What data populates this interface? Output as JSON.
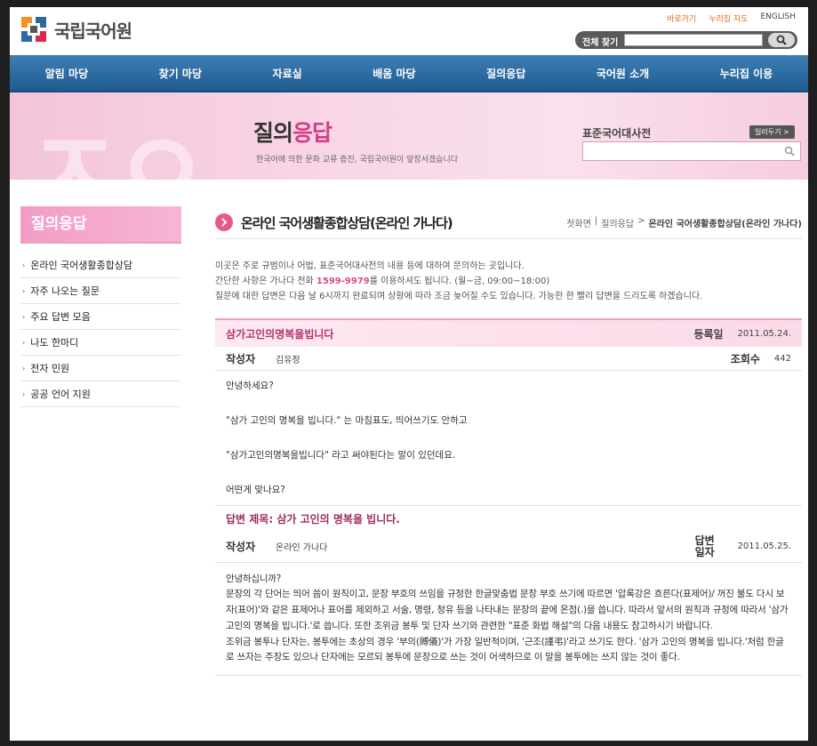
{
  "header": {
    "logo_text": "국립국어원",
    "util_links": [
      "바로가기",
      "누리집 지도",
      "ENGLISH"
    ],
    "search_label": "전체 찾기",
    "search_value": ""
  },
  "nav": [
    "알림 마당",
    "찾기 마당",
    "자료실",
    "배움 마당",
    "질의응답",
    "국어원 소개",
    "누리집 이용"
  ],
  "banner": {
    "title_part1": "질의",
    "title_part2": "응답",
    "subtitle": "한국어에 의한 문화 교류 증진, 국립국어원이 앞장서겠습니다",
    "dict_label": "표준국어대사전",
    "dict_more": "일러두기 >"
  },
  "sidebar": {
    "title": "질의응답",
    "items": [
      "온라인 국어생활종합상담",
      "자주 나오는 질문",
      "주요 답변 모음",
      "나도 한마디",
      "전자 민원",
      "공공 언어 지원"
    ]
  },
  "main": {
    "title": "온라인 국어생활종합상담(온라인 가나다)",
    "breadcrumb": [
      "첫화면",
      "질의응답",
      "온라인 국어생활종합상담(온라인 가나다)"
    ],
    "intro_line1": "이곳은 주로 규범이나 어법, 표준국어대사전의 내용 등에 대하여 문의하는 곳입니다.",
    "intro_line2_pre": "간단한 사항은 가나다 전화 ",
    "intro_phone": "1599-9979",
    "intro_line2_post": "를 이용하셔도 됩니다. (월~금, 09:00~18:00)",
    "intro_line3": "질문에 대한 답변은 다음 날 6시까지 완료되며 상황에 따라 조금 늦어질 수도 있습니다. 가능한 한 빨리 답변을 드리도록 하겠습니다."
  },
  "question": {
    "subject": "삼가고인의명복을빕니다",
    "date_label": "등록일",
    "date": "2011.05.24.",
    "author_label": "작성자",
    "author": "김유정",
    "views_label": "조회수",
    "views": "442",
    "body": [
      "안녕하세요?",
      "\"삼가 고인의 명복을 빕니다.\" 는 마침표도, 띄어쓰기도 안하고",
      "\"삼가고인의명복을빕니다\" 라고 써야된다는 말이 있던데요.",
      "어떤게 맞나요?"
    ]
  },
  "answer": {
    "title": "답변 제목: 삼가 고인의 명복을 빕니다.",
    "author_label": "작성자",
    "author": "온라인 가나다",
    "date_label": "답변일자",
    "date": "2011.05.25.",
    "body": [
      "안녕하십니까?",
      "문장의 각 단어는 띄어 씀이 원칙이고, 문장 부호의 쓰임을 규정한 한글맞춤법 문장 부호 쓰기에 따르면 '압록강은 흐른다(표제어)/ 꺼진 불도 다시 보자(표어)'와 같은 표제어나 표어를 제외하고 서술, 명령, 청유 등을 나타내는 문장의 끝에 온점(.)을 씁니다. 따라서 앞서의 원칙과 규정에 따라서 '삼가 고인의 명복을 빕니다.'로 씁니다. 또한 조위금 봉투 및 단자 쓰기와 관련한 \"표준 화법 해설\"의 다음 내용도 참고하시기 바랍니다.",
      "조위금 봉투나 단자는, 봉투에는 초상의 경우 '부의(賻儀)'가 가장 일반적이며, '근조(謹弔)'라고 쓰기도 한다. '삼가 고인의 명복을 빕니다.'처럼 한글로 쓰자는 주장도 있으나 단자에는 모르되 봉투에 문장으로 쓰는 것이 어색하므로 이 말을 봉투에는 쓰지 않는 것이 좋다."
    ]
  },
  "colors": {
    "accent": "#d73a86",
    "nav": "#2a6aa3",
    "util": "#e06a1c"
  }
}
